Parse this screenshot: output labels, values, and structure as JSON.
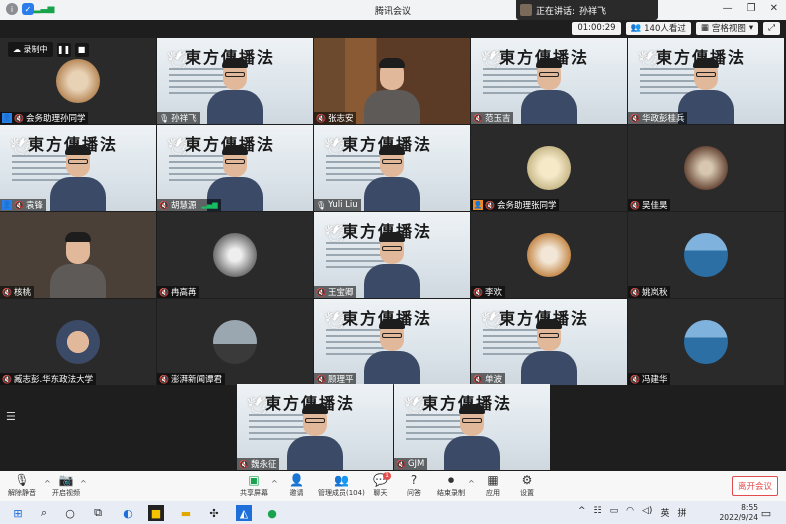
{
  "window": {
    "title": "腾讯会议"
  },
  "speaking": {
    "prefix": "正在讲话:",
    "name": "孙祥飞"
  },
  "infobar": {
    "duration": "01:00:29",
    "viewers": "140人看过",
    "view_mode": "宫格视图"
  },
  "recording": {
    "label": "录制中"
  },
  "tiles": [
    {
      "name": "会务助理孙同学",
      "type": "dog",
      "host": true
    },
    {
      "name": "孙祥飞",
      "type": "slide-person",
      "mic": "on"
    },
    {
      "name": "张志安",
      "type": "bookshelf"
    },
    {
      "name": "范玉吉",
      "type": "slide-person"
    },
    {
      "name": "华政彭桂兵",
      "type": "slide-person"
    },
    {
      "name": "袁锋",
      "type": "slide-person",
      "host": true
    },
    {
      "name": "胡慧源",
      "type": "slide-person",
      "bars": true
    },
    {
      "name": "Yuli Liu",
      "type": "slide-person",
      "mic": "on"
    },
    {
      "name": "会务助理张同学",
      "type": "avatar",
      "host_orange": true
    },
    {
      "name": "吴佳昊",
      "type": "avatar-dark"
    },
    {
      "name": "核桃",
      "type": "person-dark"
    },
    {
      "name": "冉高苒",
      "type": "avatar-bw"
    },
    {
      "name": "王宝卿",
      "type": "slide-person"
    },
    {
      "name": "李欢",
      "type": "dog-shiba"
    },
    {
      "name": "姚岚秋",
      "type": "lake"
    },
    {
      "name": "臧志彭.华东政法大学",
      "type": "avatar-person"
    },
    {
      "name": "澎湃新闻谭君",
      "type": "sunset"
    },
    {
      "name": "顾理平",
      "type": "slide-person"
    },
    {
      "name": "单波",
      "type": "slide-person"
    },
    {
      "name": "冯建华",
      "type": "lake"
    },
    {
      "name": "魏永征",
      "type": "slide-person"
    },
    {
      "name": "GJM",
      "type": "slide-person"
    }
  ],
  "toolbar": {
    "mute": "解除静音",
    "video": "开启视频",
    "share": "共享屏幕",
    "invite": "邀请",
    "members": "管理成员(104)",
    "chat": "聊天",
    "chat_badge": "1",
    "qa": "问答",
    "record": "结束录制",
    "apps": "应用",
    "settings": "设置",
    "leave": "离开会议"
  },
  "taskbar": {
    "time": "8:55",
    "date": "2022/9/24",
    "lang": "英",
    "ime": "拼"
  }
}
